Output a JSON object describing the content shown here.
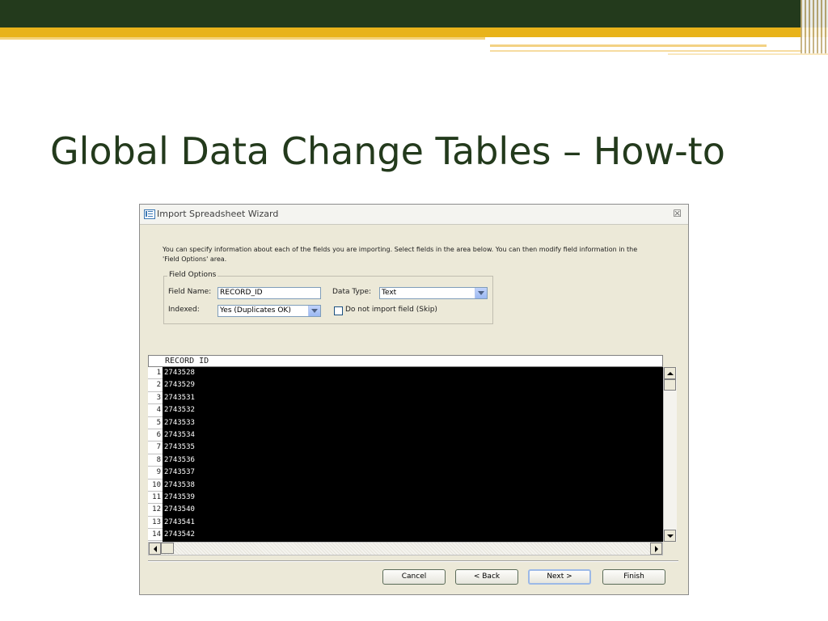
{
  "slide": {
    "title": "Global Data Change Tables – How-to"
  },
  "dialog": {
    "title": "Import Spreadsheet Wizard",
    "close_glyph": "☒",
    "description": "You can specify information about each of the fields you are importing. Select fields in the area below. You can then modify field information in the 'Field Options' area.",
    "field_options": {
      "legend": "Field Options",
      "field_name_label": "Field Name:",
      "field_name_value": "RECORD_ID",
      "data_type_label": "Data Type:",
      "data_type_value": "Text",
      "indexed_label": "Indexed:",
      "indexed_value": "Yes (Duplicates OK)",
      "skip_label": "Do not import field (Skip)",
      "skip_checked": false
    },
    "grid": {
      "column_header": "RECORD ID",
      "rows": [
        {
          "num": "1",
          "value": "2743528"
        },
        {
          "num": "2",
          "value": "2743529"
        },
        {
          "num": "3",
          "value": "2743531"
        },
        {
          "num": "4",
          "value": "2743532"
        },
        {
          "num": "5",
          "value": "2743533"
        },
        {
          "num": "6",
          "value": "2743534"
        },
        {
          "num": "7",
          "value": "2743535"
        },
        {
          "num": "8",
          "value": "2743536"
        },
        {
          "num": "9",
          "value": "2743537"
        },
        {
          "num": "10",
          "value": "2743538"
        },
        {
          "num": "11",
          "value": "2743539"
        },
        {
          "num": "12",
          "value": "2743540"
        },
        {
          "num": "13",
          "value": "2743541"
        },
        {
          "num": "14",
          "value": "2743542"
        }
      ]
    },
    "buttons": {
      "cancel": "Cancel",
      "back": "< Back",
      "next": "Next >",
      "finish": "Finish"
    }
  },
  "colors": {
    "header_dark": "#233a1c",
    "header_gold": "#e8b31a",
    "title_green": "#233a1c",
    "dialog_bg": "#ece9d8",
    "grid_selected_bg": "#000000"
  }
}
